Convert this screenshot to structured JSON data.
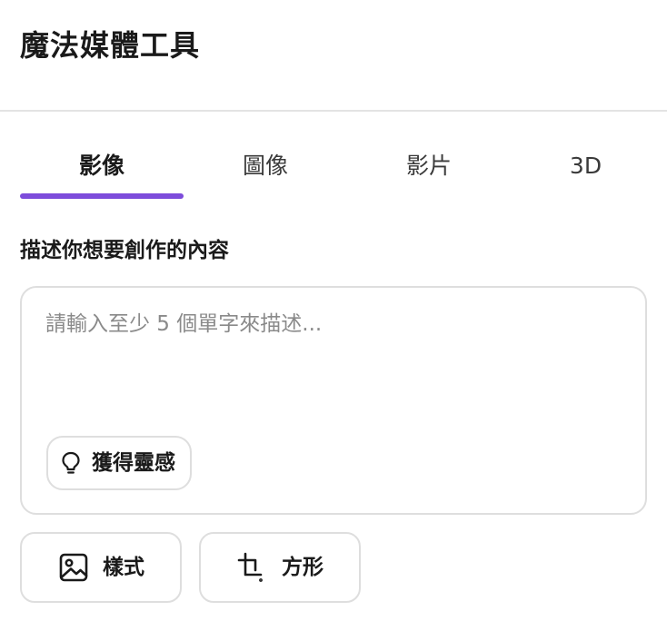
{
  "header": {
    "title": "魔法媒體工具"
  },
  "tabs": [
    {
      "label": "影像",
      "active": true
    },
    {
      "label": "圖像",
      "active": false
    },
    {
      "label": "影片",
      "active": false
    },
    {
      "label": "3D",
      "active": false
    }
  ],
  "prompt": {
    "label": "描述你想要創作的內容",
    "value": "",
    "placeholder": "請輸入至少 5 個單字來描述..."
  },
  "inspire_button": {
    "label": "獲得靈感",
    "icon": "lightbulb-icon"
  },
  "options": {
    "style": {
      "label": "樣式",
      "icon": "image-icon"
    },
    "aspect": {
      "label": "方形",
      "icon": "crop-icon"
    }
  },
  "colors": {
    "accent": "#7d4cdb",
    "border": "#dedede",
    "placeholder": "#8a8a8a"
  }
}
